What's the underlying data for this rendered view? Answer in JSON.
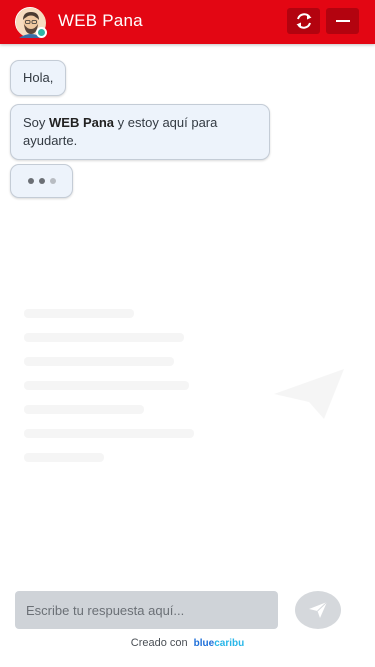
{
  "header": {
    "title": "WEB Pana",
    "avatar_icon": "avatar-icon",
    "refresh_icon": "refresh-icon",
    "minimize_icon": "minimize-icon",
    "brand_color": "#e30613",
    "status_color": "#2fb5a4"
  },
  "messages": [
    {
      "text": "Hola,"
    },
    {
      "prefix": "Soy ",
      "bold": "WEB Pana",
      "suffix": " y estoy aquí para ayudarte."
    }
  ],
  "typing_indicator": {
    "icon": "typing-dots-icon"
  },
  "composer": {
    "placeholder": "Escribe tu respuesta aquí...",
    "send_icon": "send-icon"
  },
  "footer": {
    "credit_text": "Creado con",
    "brand_part1": "blue",
    "brand_part2": "caribu"
  }
}
